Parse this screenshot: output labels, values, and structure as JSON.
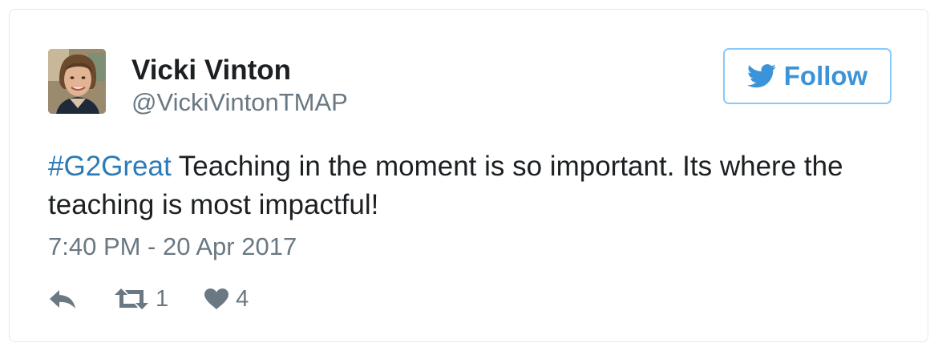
{
  "tweet": {
    "author_name": "Vicki Vinton",
    "author_handle": "@VickiVintonTMAP",
    "follow_label": "Follow",
    "hashtag": "#G2Great",
    "text": " Teaching in the moment is so important. Its where the teaching is most impactful!",
    "timestamp": "7:40 PM - 20 Apr 2017",
    "retweet_count": "1",
    "like_count": "4"
  },
  "colors": {
    "text": "#1c2022",
    "secondary": "#697882",
    "link": "#2b7bb9",
    "brand": "#3b94d9",
    "border": "#e1e8ed"
  },
  "icons": {
    "follow": "twitter-bird-icon",
    "reply": "reply-icon",
    "retweet": "retweet-icon",
    "like": "heart-icon"
  }
}
